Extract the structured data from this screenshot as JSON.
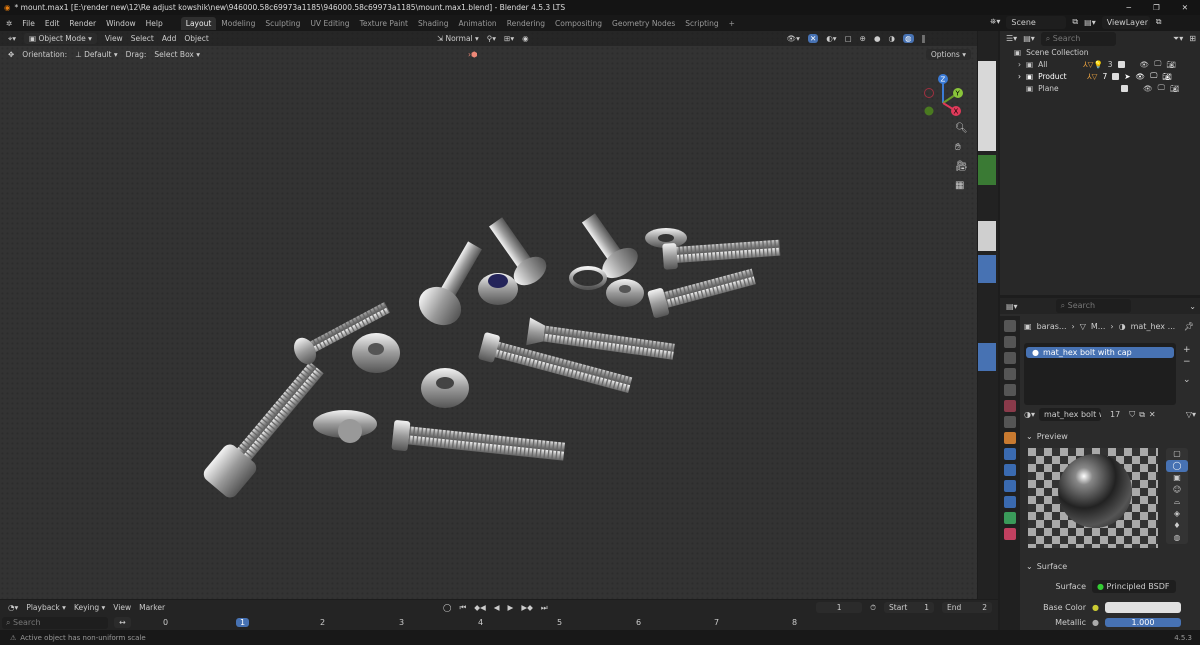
{
  "window": {
    "title": "* mount.max1 [E:\\render new\\12\\Re adjust kowshik\\new\\946000.58c69973a1185\\946000.58c69973a1185\\mount.max1.blend] - Blender 4.5.3 LTS",
    "minimize": "─",
    "maximize": "❐",
    "close": "✕"
  },
  "menu": {
    "items": [
      "File",
      "Edit",
      "Render",
      "Window",
      "Help"
    ],
    "workspaces": [
      "Layout",
      "Modeling",
      "Sculpting",
      "UV Editing",
      "Texture Paint",
      "Shading",
      "Animation",
      "Rendering",
      "Compositing",
      "Geometry Nodes",
      "Scripting"
    ],
    "active": "Layout",
    "add": "+"
  },
  "viewport": {
    "mode": "Object Mode",
    "menus": [
      "View",
      "Select",
      "Add",
      "Object"
    ],
    "orientation_label": "Orientation:",
    "orientation": "Default",
    "drag_label": "Drag:",
    "drag": "Select Box",
    "transform": "Normal",
    "options": "Options",
    "gizmo": {
      "x": "X",
      "y": "Y",
      "z": "Z"
    }
  },
  "outliner": {
    "scene": "Scene",
    "view_layer": "ViewLayer",
    "search_placeholder": "Search",
    "root": "Scene Collection",
    "items": [
      {
        "name": "All",
        "count": "3"
      },
      {
        "name": "Product",
        "count": "7"
      },
      {
        "name": "Plane"
      }
    ]
  },
  "properties": {
    "search_placeholder": "Search",
    "breadcrumb": [
      "baras...",
      "M...",
      "mat_hex ..."
    ],
    "slot": "mat_hex bolt with cap",
    "material_name": "mat_hex bolt with...",
    "users": "17",
    "preview_label": "Preview",
    "surface_section": "Surface",
    "surface_label": "Surface",
    "surface_value": "Principled BSDF",
    "base_color_label": "Base Color",
    "base_color": "#e0e0e0",
    "metallic_label": "Metallic",
    "metallic": "1.000"
  },
  "timeline": {
    "menus": [
      "Playback",
      "Keying",
      "View",
      "Marker"
    ],
    "current_frame": "1",
    "start_label": "Start",
    "start": "1",
    "end_label": "End",
    "end": "2",
    "search_placeholder": "Search",
    "ticks": [
      "0",
      "1",
      "2",
      "3",
      "4",
      "5",
      "6",
      "7",
      "8"
    ]
  },
  "status": {
    "message": "Active object has non-uniform scale",
    "version": "4.5.3"
  },
  "colors": {
    "accent": "#4772b3",
    "selected_green": "#3a7a34"
  }
}
